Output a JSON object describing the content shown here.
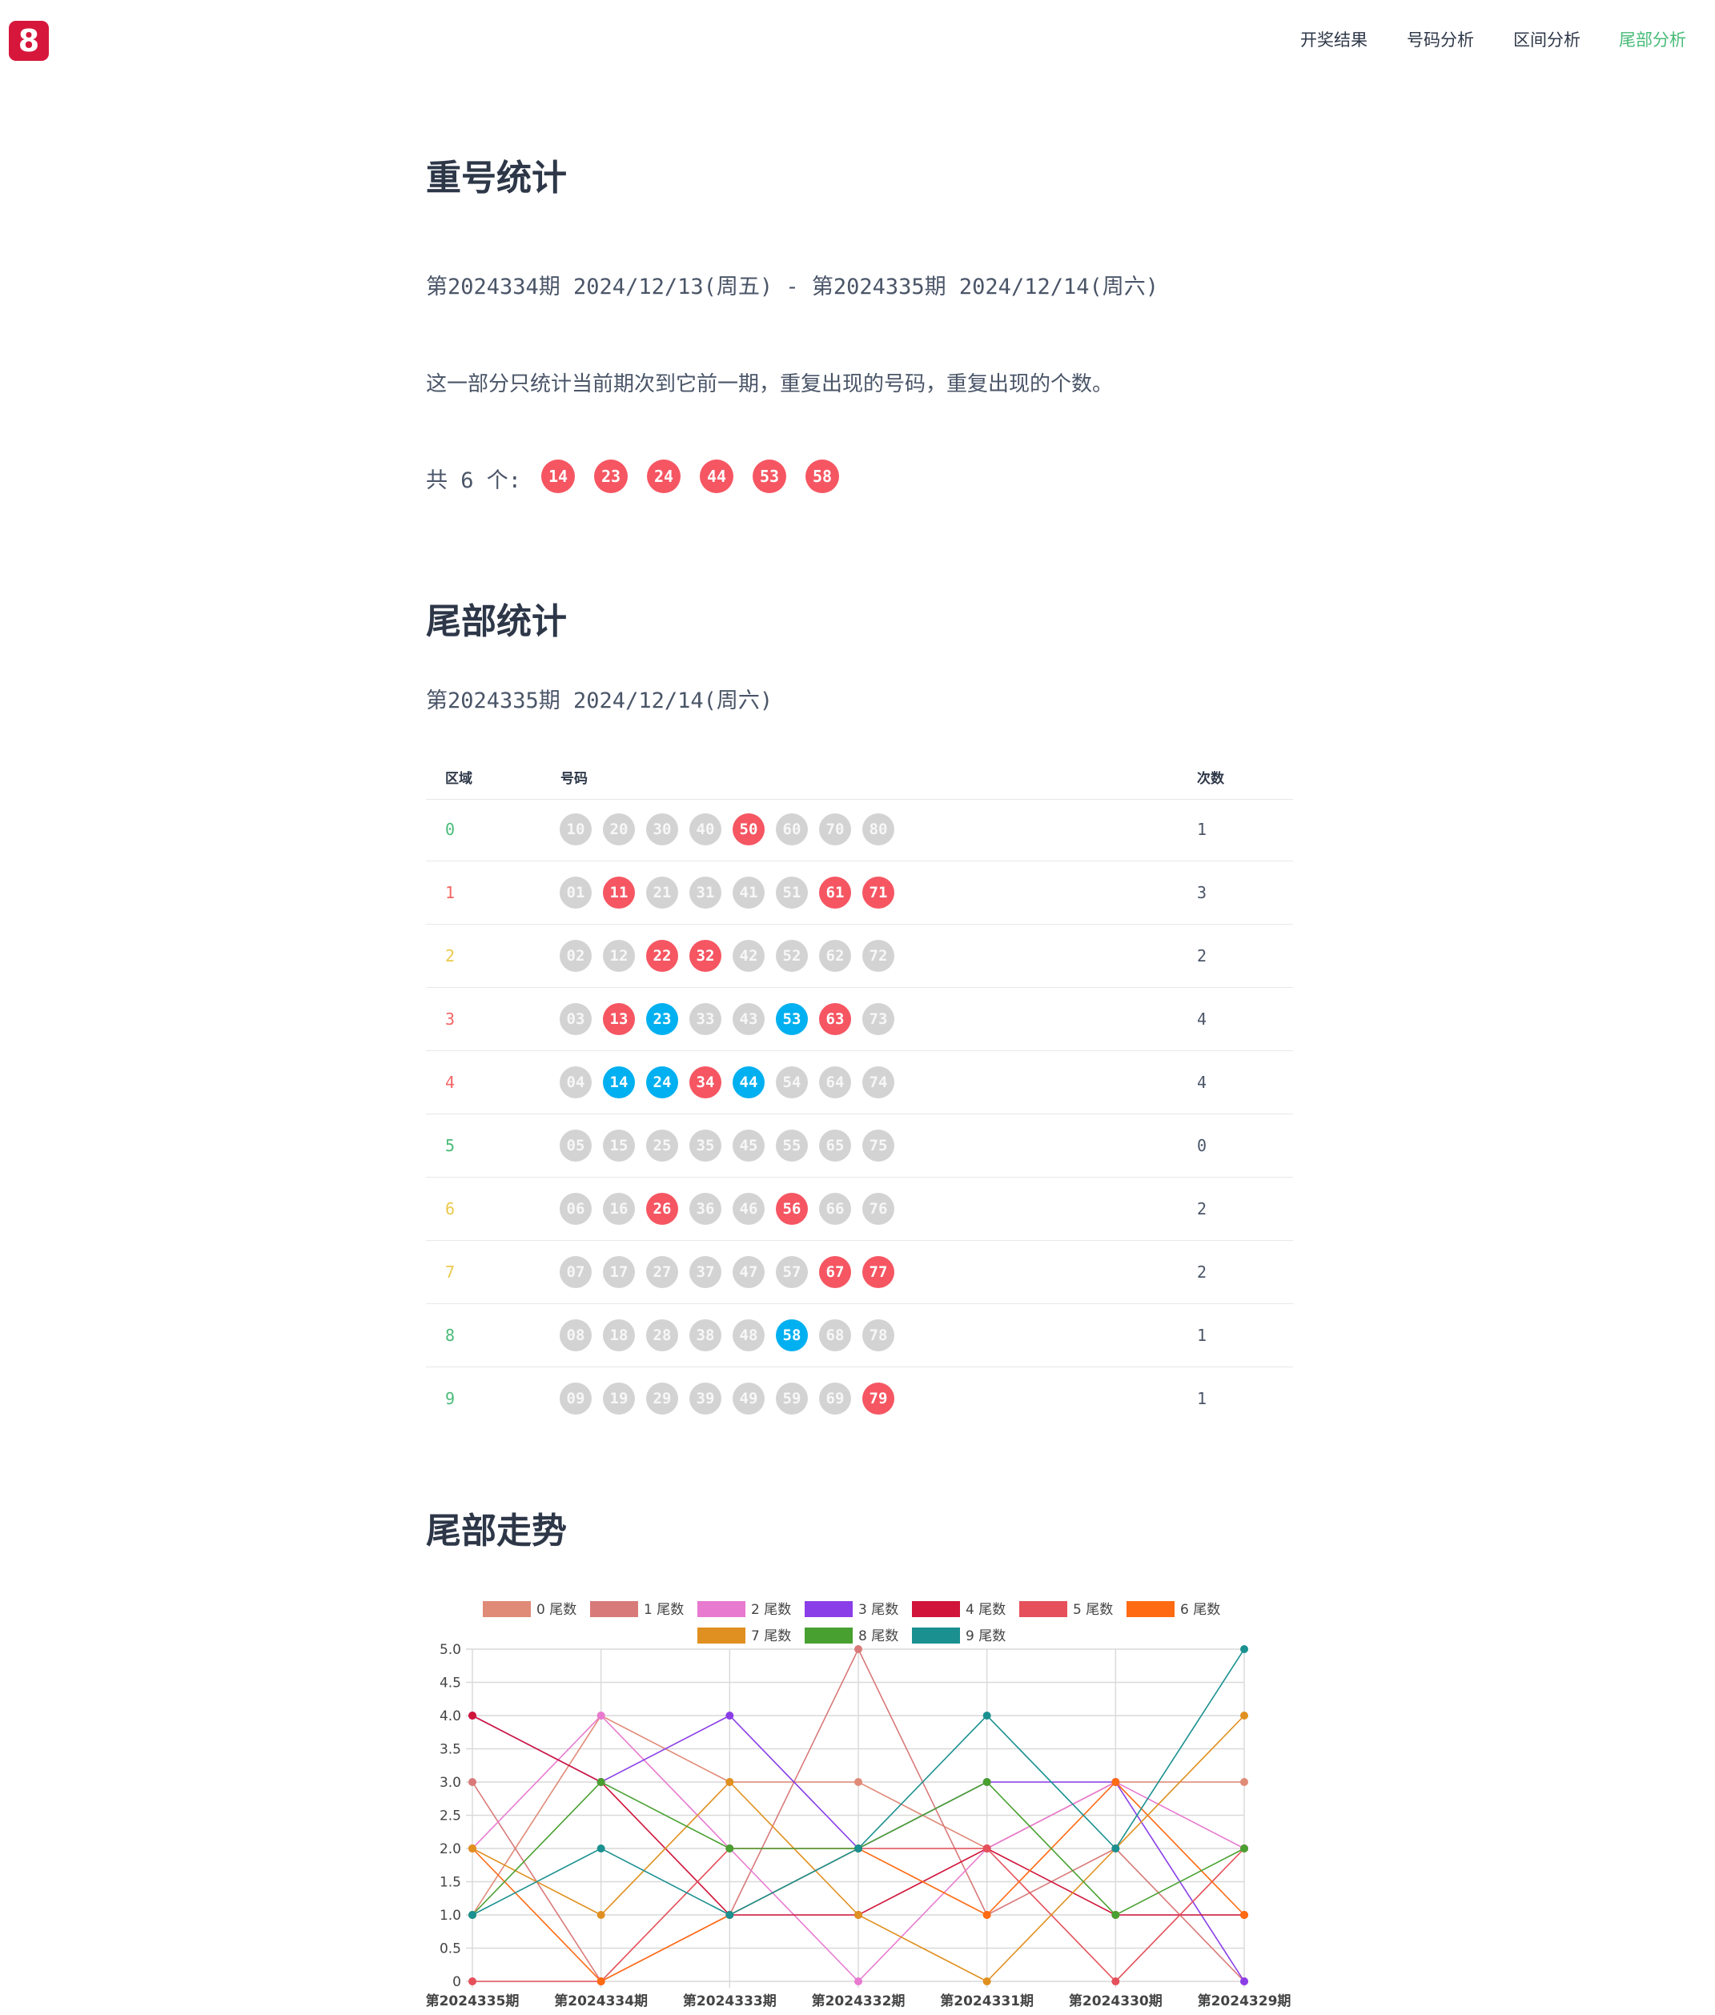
{
  "logo": {
    "glyph": "8",
    "color": "#d6173b"
  },
  "nav": {
    "items": [
      {
        "label": "开奖结果"
      },
      {
        "label": "号码分析"
      },
      {
        "label": "区间分析"
      },
      {
        "label": "尾部分析"
      }
    ],
    "active_index": 3,
    "active_color": "#48bb78"
  },
  "repeat": {
    "title": "重号统计",
    "period": "第2024334期 2024/12/13(周五) - 第2024335期 2024/12/14(周六)",
    "description": "这一部分只统计当前期次到它前一期，重复出现的号码，重复出现的个数。",
    "total_label": "共 6 个:",
    "numbers": [
      "14",
      "23",
      "24",
      "44",
      "53",
      "58"
    ]
  },
  "tail": {
    "title": "尾部统计",
    "period": "第2024335期 2024/12/14(周六)",
    "headers": {
      "zone": "区域",
      "numbers": "号码",
      "count": "次数"
    },
    "colors": {
      "gray": "#d3d3d3",
      "red": "#f55662",
      "blue": "#00b0f0"
    },
    "rows": [
      {
        "zone": "0",
        "zone_color": "#48bb78",
        "balls": [
          [
            "10",
            "gray"
          ],
          [
            "20",
            "gray"
          ],
          [
            "30",
            "gray"
          ],
          [
            "40",
            "gray"
          ],
          [
            "50",
            "red"
          ],
          [
            "60",
            "gray"
          ],
          [
            "70",
            "gray"
          ],
          [
            "80",
            "gray"
          ]
        ],
        "count": "1"
      },
      {
        "zone": "1",
        "zone_color": "#f56565",
        "balls": [
          [
            "01",
            "gray"
          ],
          [
            "11",
            "red"
          ],
          [
            "21",
            "gray"
          ],
          [
            "31",
            "gray"
          ],
          [
            "41",
            "gray"
          ],
          [
            "51",
            "gray"
          ],
          [
            "61",
            "red"
          ],
          [
            "71",
            "red"
          ]
        ],
        "count": "3"
      },
      {
        "zone": "2",
        "zone_color": "#ecc94b",
        "balls": [
          [
            "02",
            "gray"
          ],
          [
            "12",
            "gray"
          ],
          [
            "22",
            "red"
          ],
          [
            "32",
            "red"
          ],
          [
            "42",
            "gray"
          ],
          [
            "52",
            "gray"
          ],
          [
            "62",
            "gray"
          ],
          [
            "72",
            "gray"
          ]
        ],
        "count": "2"
      },
      {
        "zone": "3",
        "zone_color": "#f56565",
        "balls": [
          [
            "03",
            "gray"
          ],
          [
            "13",
            "red"
          ],
          [
            "23",
            "blue"
          ],
          [
            "33",
            "gray"
          ],
          [
            "43",
            "gray"
          ],
          [
            "53",
            "blue"
          ],
          [
            "63",
            "red"
          ],
          [
            "73",
            "gray"
          ]
        ],
        "count": "4"
      },
      {
        "zone": "4",
        "zone_color": "#f56565",
        "balls": [
          [
            "04",
            "gray"
          ],
          [
            "14",
            "blue"
          ],
          [
            "24",
            "blue"
          ],
          [
            "34",
            "red"
          ],
          [
            "44",
            "blue"
          ],
          [
            "54",
            "gray"
          ],
          [
            "64",
            "gray"
          ],
          [
            "74",
            "gray"
          ]
        ],
        "count": "4"
      },
      {
        "zone": "5",
        "zone_color": "#48bb78",
        "balls": [
          [
            "05",
            "gray"
          ],
          [
            "15",
            "gray"
          ],
          [
            "25",
            "gray"
          ],
          [
            "35",
            "gray"
          ],
          [
            "45",
            "gray"
          ],
          [
            "55",
            "gray"
          ],
          [
            "65",
            "gray"
          ],
          [
            "75",
            "gray"
          ]
        ],
        "count": "0"
      },
      {
        "zone": "6",
        "zone_color": "#ecc94b",
        "balls": [
          [
            "06",
            "gray"
          ],
          [
            "16",
            "gray"
          ],
          [
            "26",
            "red"
          ],
          [
            "36",
            "gray"
          ],
          [
            "46",
            "gray"
          ],
          [
            "56",
            "red"
          ],
          [
            "66",
            "gray"
          ],
          [
            "76",
            "gray"
          ]
        ],
        "count": "2"
      },
      {
        "zone": "7",
        "zone_color": "#ecc94b",
        "balls": [
          [
            "07",
            "gray"
          ],
          [
            "17",
            "gray"
          ],
          [
            "27",
            "gray"
          ],
          [
            "37",
            "gray"
          ],
          [
            "47",
            "gray"
          ],
          [
            "57",
            "gray"
          ],
          [
            "67",
            "red"
          ],
          [
            "77",
            "red"
          ]
        ],
        "count": "2"
      },
      {
        "zone": "8",
        "zone_color": "#48bb78",
        "balls": [
          [
            "08",
            "gray"
          ],
          [
            "18",
            "gray"
          ],
          [
            "28",
            "gray"
          ],
          [
            "38",
            "gray"
          ],
          [
            "48",
            "gray"
          ],
          [
            "58",
            "blue"
          ],
          [
            "68",
            "gray"
          ],
          [
            "78",
            "gray"
          ]
        ],
        "count": "1"
      },
      {
        "zone": "9",
        "zone_color": "#48bb78",
        "balls": [
          [
            "09",
            "gray"
          ],
          [
            "19",
            "gray"
          ],
          [
            "29",
            "gray"
          ],
          [
            "39",
            "gray"
          ],
          [
            "49",
            "gray"
          ],
          [
            "59",
            "gray"
          ],
          [
            "69",
            "gray"
          ],
          [
            "79",
            "red"
          ]
        ],
        "count": "1"
      }
    ]
  },
  "trend": {
    "title": "尾部走势"
  },
  "chart_data": {
    "type": "line",
    "categories": [
      "第2024335期",
      "第2024334期",
      "第2024333期",
      "第2024332期",
      "第2024331期",
      "第2024330期",
      "第2024329期"
    ],
    "ylim": [
      0,
      5
    ],
    "yticks": [
      "0",
      "0.5",
      "1.0",
      "1.5",
      "2.0",
      "2.5",
      "3.0",
      "3.5",
      "4.0",
      "4.5",
      "5.0"
    ],
    "grid": true,
    "legend": "top",
    "series": [
      {
        "name": "0 尾数",
        "color": "#e08a78",
        "values": [
          1,
          4,
          3,
          3,
          2,
          3,
          3
        ]
      },
      {
        "name": "1 尾数",
        "color": "#d97a7a",
        "values": [
          3,
          0,
          1,
          5,
          1,
          2,
          0
        ]
      },
      {
        "name": "2 尾数",
        "color": "#e87ad0",
        "values": [
          2,
          4,
          2,
          0,
          2,
          3,
          2
        ]
      },
      {
        "name": "3 尾数",
        "color": "#8a3ee8",
        "values": [
          4,
          3,
          4,
          2,
          3,
          3,
          0
        ]
      },
      {
        "name": "4 尾数",
        "color": "#d0143a",
        "values": [
          4,
          3,
          1,
          1,
          2,
          1,
          1
        ]
      },
      {
        "name": "5 尾数",
        "color": "#e5505a",
        "values": [
          0,
          0,
          2,
          2,
          2,
          0,
          2
        ]
      },
      {
        "name": "6 尾数",
        "color": "#ff6a12",
        "values": [
          2,
          0,
          1,
          2,
          1,
          3,
          1
        ]
      },
      {
        "name": "7 尾数",
        "color": "#e09020",
        "values": [
          2,
          1,
          3,
          1,
          0,
          2,
          4
        ]
      },
      {
        "name": "8 尾数",
        "color": "#48a030",
        "values": [
          1,
          3,
          2,
          2,
          3,
          1,
          2
        ]
      },
      {
        "name": "9 尾数",
        "color": "#1a9090",
        "values": [
          1,
          2,
          1,
          2,
          4,
          2,
          5
        ]
      }
    ]
  }
}
